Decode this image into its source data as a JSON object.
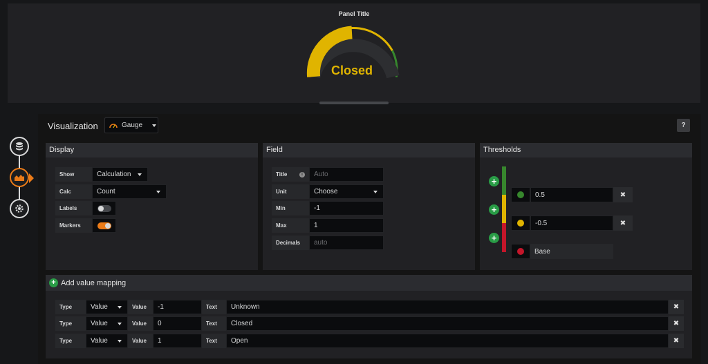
{
  "preview": {
    "panel_title": "Panel Title",
    "gauge_value_text": "Closed",
    "gauge_fill_fraction": 0.5,
    "colors": {
      "green": "#37872d",
      "yellow": "#e0b400",
      "red": "#c4162a"
    }
  },
  "editor": {
    "visualization_label": "Visualization",
    "visualization_value": "Gauge",
    "help_label": "?"
  },
  "nav": {
    "icons": [
      "database-icon",
      "chart-icon",
      "gear-icon"
    ],
    "active": "chart-icon"
  },
  "display": {
    "title": "Display",
    "show_label": "Show",
    "show_value": "Calculation",
    "calc_label": "Calc",
    "calc_value": "Count",
    "labels_label": "Labels",
    "labels_on": false,
    "markers_label": "Markers",
    "markers_on": true
  },
  "field": {
    "title": "Field",
    "title_label": "Title",
    "title_placeholder": "Auto",
    "unit_label": "Unit",
    "unit_value": "Choose",
    "min_label": "Min",
    "min_value": "-1",
    "max_label": "Max",
    "max_value": "1",
    "decimals_label": "Decimals",
    "decimals_placeholder": "auto"
  },
  "thresholds": {
    "title": "Thresholds",
    "items": [
      {
        "value": "0.5",
        "color": "#37872d"
      },
      {
        "value": "-0.5",
        "color": "#e0b400"
      },
      {
        "value": "Base",
        "color": "#c4162a"
      }
    ]
  },
  "mappings": {
    "add_label": "Add value mapping",
    "type_label": "Type",
    "value_label": "Value",
    "text_label": "Text",
    "rows": [
      {
        "type": "Value",
        "value": "-1",
        "text": "Unknown"
      },
      {
        "type": "Value",
        "value": "0",
        "text": "Closed"
      },
      {
        "type": "Value",
        "value": "1",
        "text": "Open"
      }
    ]
  }
}
